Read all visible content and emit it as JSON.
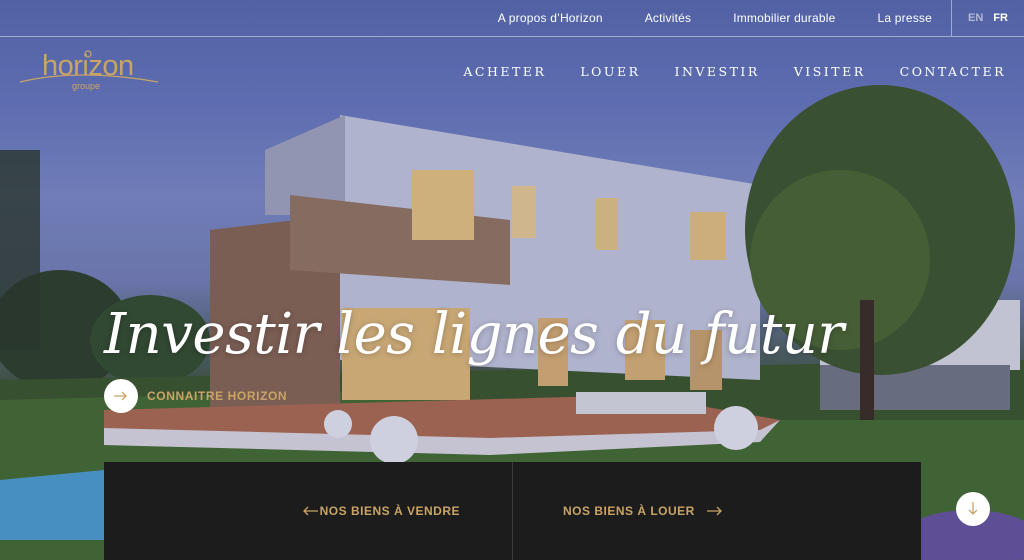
{
  "topnav": {
    "items": [
      "A propos d’Horizon",
      "Activités",
      "Immobilier durable",
      "La presse"
    ],
    "lang_en": "EN",
    "lang_fr": "FR"
  },
  "logo": {
    "name": "horizon",
    "sub": "groupe"
  },
  "mainnav": {
    "items": [
      "ACHETER",
      "LOUER",
      "INVESTIR",
      "VISITER",
      "CONTACTER"
    ]
  },
  "hero": {
    "headline": "Investir les lignes du futur",
    "cta_label": "CONNAITRE HORIZON"
  },
  "panel": {
    "sale_label": "NOS BIENS À VENDRE",
    "rent_label": "NOS BIENS À LOUER"
  },
  "icons": {
    "cta": "arrow-right-icon",
    "sale": "arrow-left-icon",
    "rent": "arrow-right-icon",
    "scroll": "arrow-down-icon"
  },
  "colors": {
    "accent": "#c9a466",
    "panel": "#1c1c1c",
    "text": "#ffffff"
  }
}
